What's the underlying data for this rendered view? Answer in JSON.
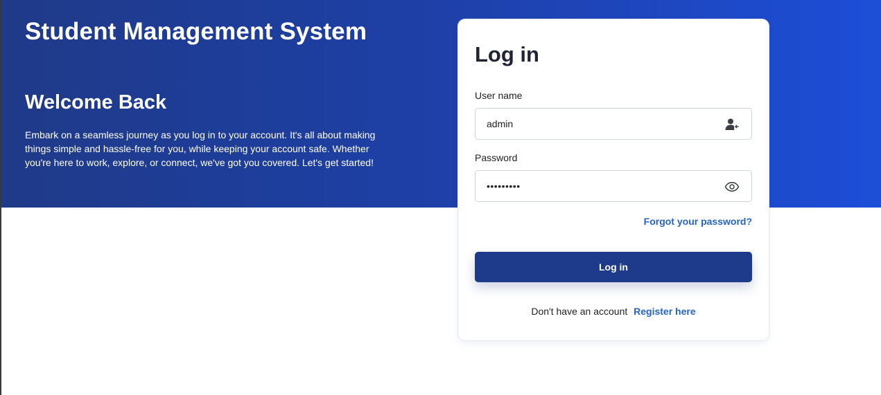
{
  "header": {
    "app_title": "Student Management System",
    "welcome_title": "Welcome Back",
    "welcome_text": "Embark on a seamless journey as you log in to your account. It's all about making things simple and hassle-free for you, while keeping your account safe. Whether you're here to work, explore, or connect, we've got you covered. Let's get started!"
  },
  "login_form": {
    "title": "Log in",
    "username": {
      "label": "User name",
      "value": "admin",
      "icon": "user-icon"
    },
    "password": {
      "label": "Password",
      "value": "•••••••••",
      "icon": "eye-icon"
    },
    "forgot_password_label": "Forgot your password?",
    "submit_label": "Log in",
    "register_prompt": "Don't have an account",
    "register_link_label": "Register here"
  },
  "colors": {
    "hero_gradient_start": "#1f3a88",
    "hero_gradient_end": "#1d4ed8",
    "primary_button": "#1e3a8a",
    "link": "#2563c9",
    "card_title": "#1e2433"
  }
}
